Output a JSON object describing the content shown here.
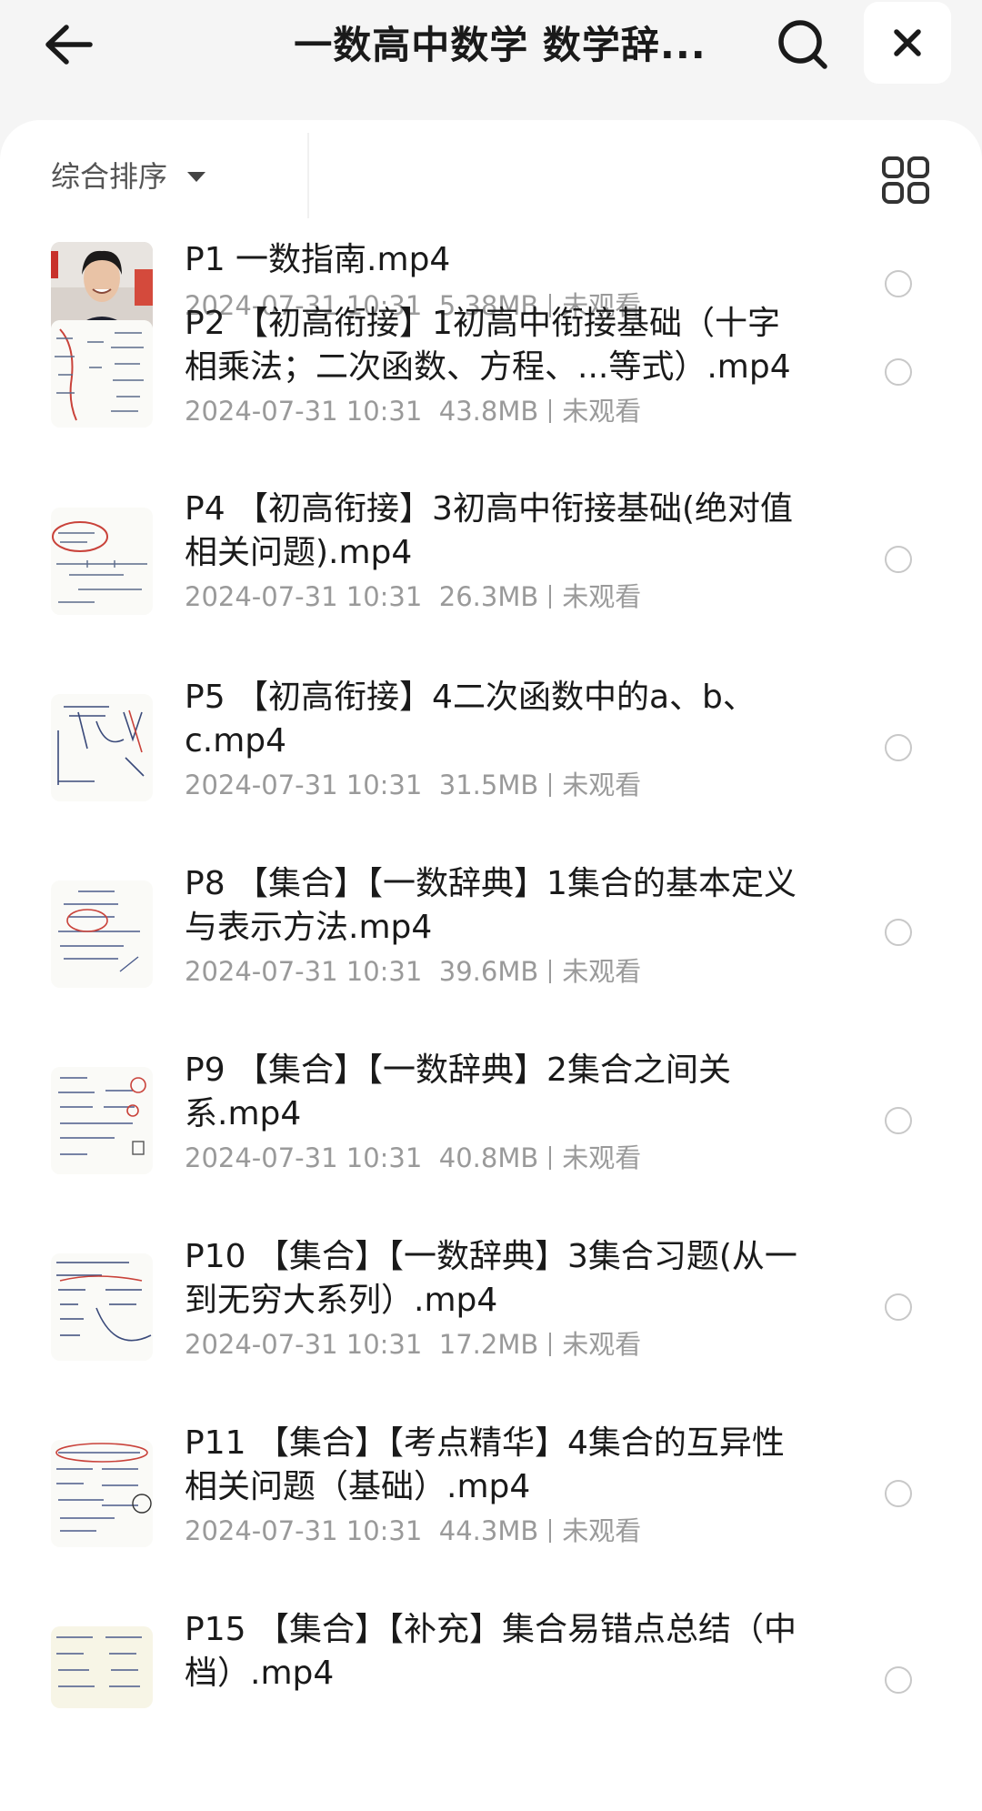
{
  "header": {
    "title": "一数高中数学 数学辞...",
    "back_icon": "arrow-left-icon",
    "search_icon": "search-icon",
    "close_icon": "close-icon"
  },
  "toolbar": {
    "sort_label": "综合排序",
    "view_icon": "grid-view-icon"
  },
  "items": [
    {
      "title": "P1 一数指南.mp4",
      "date": "2024-07-31 10:31",
      "size": "5.38MB",
      "status": "未观看",
      "thumb": "photo"
    },
    {
      "title": "P2 【初高衔接】1初高中衔接基础（十字相乘法；二次函数、方程、...等式）.mp4",
      "date": "2024-07-31 10:31",
      "size": "43.8MB",
      "status": "未观看",
      "thumb": "notes"
    },
    {
      "title": "P4 【初高衔接】3初高中衔接基础(绝对值相关问题).mp4",
      "date": "2024-07-31 10:31",
      "size": "26.3MB",
      "status": "未观看",
      "thumb": "notes"
    },
    {
      "title": "P5 【初高衔接】4二次函数中的a、b、c.mp4",
      "date": "2024-07-31 10:31",
      "size": "31.5MB",
      "status": "未观看",
      "thumb": "notes"
    },
    {
      "title": "P8 【集合】【一数辞典】1集合的基本定义与表示方法.mp4",
      "date": "2024-07-31 10:31",
      "size": "39.6MB",
      "status": "未观看",
      "thumb": "notes"
    },
    {
      "title": "P9 【集合】【一数辞典】2集合之间关系.mp4",
      "date": "2024-07-31 10:31",
      "size": "40.8MB",
      "status": "未观看",
      "thumb": "notes"
    },
    {
      "title": "P10 【集合】【一数辞典】3集合习题(从一到无穷大系列）.mp4",
      "date": "2024-07-31 10:31",
      "size": "17.2MB",
      "status": "未观看",
      "thumb": "notes"
    },
    {
      "title": "P11 【集合】【考点精华】4集合的互异性相关问题（基础）.mp4",
      "date": "2024-07-31 10:31",
      "size": "44.3MB",
      "status": "未观看",
      "thumb": "notes"
    },
    {
      "title": "P15 【集合】【补充】集合易错点总结（中档）.mp4",
      "date": "",
      "size": "",
      "status": "",
      "thumb": "notes"
    }
  ]
}
